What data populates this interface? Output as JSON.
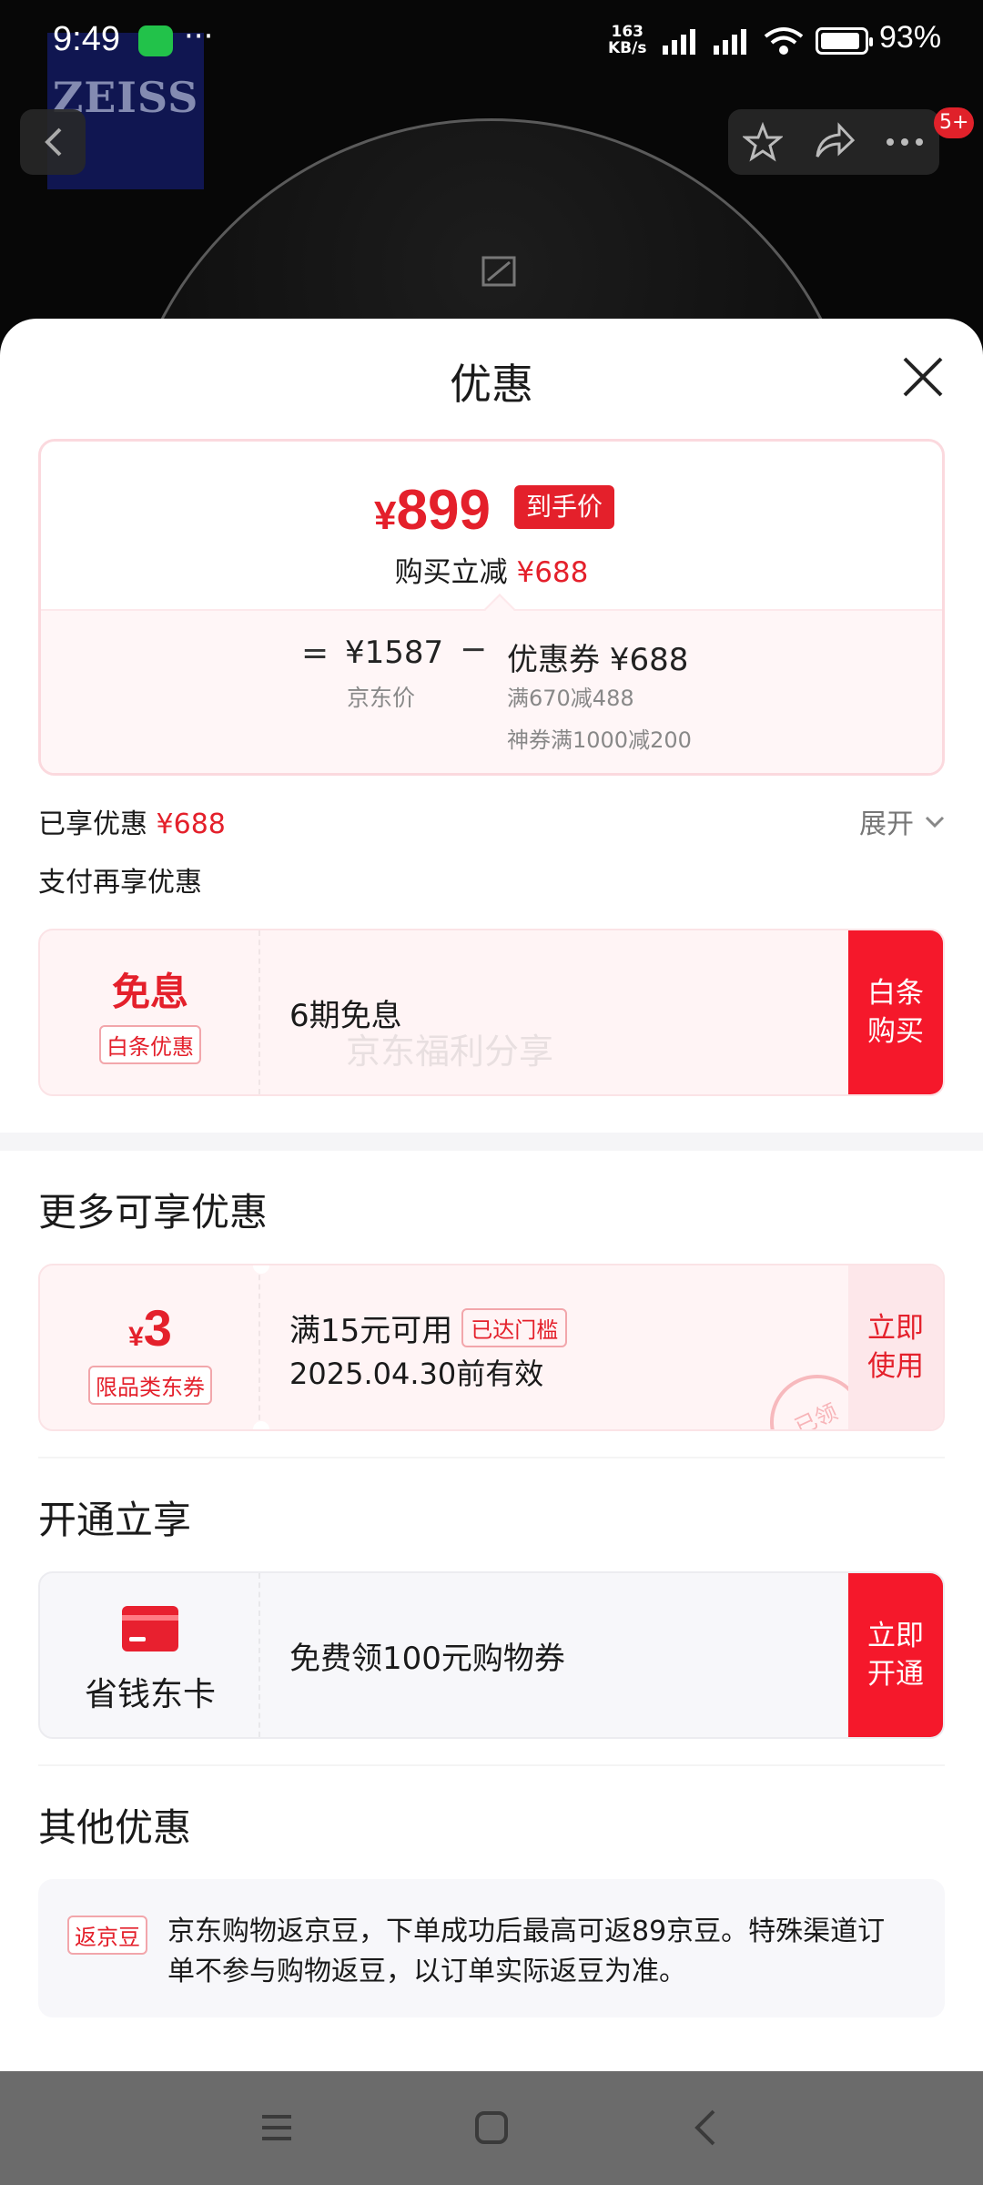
{
  "status_bar": {
    "time": "9:49",
    "net_speed_value": "163",
    "net_speed_unit": "KB/s",
    "battery_percent": "93%"
  },
  "background": {
    "logo_text": "ZEISS"
  },
  "header": {
    "notification_badge": "5+"
  },
  "sheet": {
    "title": "优惠",
    "final_price_symbol": "¥",
    "final_price": "899",
    "final_price_tag": "到手价",
    "instant_reduce_label": "购买立减",
    "instant_reduce_amount": "¥688",
    "equals": "=",
    "jd_price": "¥1587",
    "jd_price_label": "京东价",
    "minus": "−",
    "coupon_total": "优惠券 ¥688",
    "coupon_detail_1": "满670减488",
    "coupon_detail_2": "神券满1000减200",
    "enjoyed_label": "已享优惠",
    "enjoyed_amount": "¥688",
    "expand_label": "展开",
    "pay_more_label": "支付再享优惠"
  },
  "installment_card": {
    "title": "免息",
    "tag": "白条优惠",
    "desc": "6期免息",
    "watermark": "京东福利分享",
    "button": "白条\n购买"
  },
  "more_section": {
    "title": "更多可享优惠",
    "coupon_symbol": "¥",
    "coupon_value": "3",
    "coupon_tag": "限品类东券",
    "condition": "满15元可用",
    "reached_tag": "已达门槛",
    "valid_until": "2025.04.30前有效",
    "button": "立即\n使用",
    "stamp": "已领"
  },
  "open_section": {
    "title": "开通立享",
    "card_name": "省钱东卡",
    "desc": "免费领100元购物券",
    "button": "立即\n开通"
  },
  "other_section": {
    "title": "其他优惠",
    "tag": "返京豆",
    "text": "京东购物返京豆，下单成功后最高可返89京豆。特殊渠道订单不参与购物返豆，以订单实际返豆为准。"
  },
  "colors": {
    "accent": "#e4202b",
    "button_red": "#f5182b",
    "card_pink": "#fff4f5",
    "card_gray": "#f7f7fa"
  },
  "icons": [
    "wechat-icon",
    "more-dots-icon",
    "signal-icon",
    "wifi-icon",
    "battery-icon",
    "back-icon",
    "star-icon",
    "share-icon",
    "more-icon",
    "image-placeholder-icon",
    "close-icon",
    "chevron-down-icon",
    "card-icon",
    "menu-icon",
    "home-icon",
    "nav-back-icon"
  ]
}
